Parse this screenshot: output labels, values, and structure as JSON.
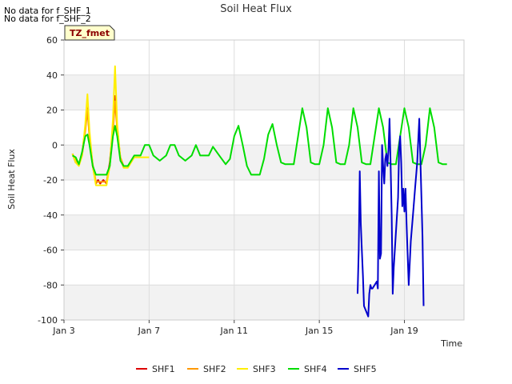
{
  "notes": [
    "No data for f_SHF_1",
    "No data for f_SHF_2"
  ],
  "badge": "TZ_fmet",
  "chart_data": {
    "type": "line",
    "title": "Soil Heat Flux",
    "xlabel": "Time",
    "ylabel": "Soil Heat Flux",
    "xlim": [
      3,
      21.8
    ],
    "ylim": [
      -100,
      60
    ],
    "xticks": [
      3,
      7,
      11,
      15,
      19
    ],
    "xtick_labels": [
      "Jan 3",
      "Jan 7",
      "Jan 11",
      "Jan 15",
      "Jan 19"
    ],
    "yticks": [
      -100,
      -80,
      -60,
      -40,
      -20,
      0,
      20,
      40,
      60
    ],
    "grid": true,
    "legend_position": "bottom",
    "series": [
      {
        "name": "SHF1",
        "color": "#dd0000",
        "values": [
          [
            3.4,
            -5
          ],
          [
            3.55,
            -10
          ],
          [
            3.7,
            -11
          ],
          [
            3.85,
            -5
          ],
          [
            4.0,
            10
          ],
          [
            4.1,
            22
          ],
          [
            4.2,
            5
          ],
          [
            4.35,
            -12
          ],
          [
            4.5,
            -22
          ],
          [
            4.6,
            -20
          ],
          [
            4.7,
            -22
          ],
          [
            4.85,
            -20
          ],
          [
            5.0,
            -22
          ],
          [
            5.15,
            -10
          ],
          [
            5.3,
            10
          ],
          [
            5.4,
            28
          ],
          [
            5.5,
            10
          ],
          [
            5.65,
            -8
          ],
          [
            5.8,
            -12
          ],
          [
            6.0,
            -12
          ]
        ]
      },
      {
        "name": "SHF2",
        "color": "#ff9900",
        "values": [
          [
            3.4,
            -5
          ],
          [
            3.55,
            -9
          ],
          [
            3.7,
            -11
          ],
          [
            3.85,
            -6
          ],
          [
            4.0,
            8
          ],
          [
            4.1,
            20
          ],
          [
            4.2,
            4
          ],
          [
            4.35,
            -11
          ],
          [
            4.5,
            -21
          ],
          [
            4.7,
            -21
          ],
          [
            5.0,
            -21
          ],
          [
            5.15,
            -12
          ],
          [
            5.3,
            8
          ],
          [
            5.4,
            25
          ],
          [
            5.5,
            8
          ],
          [
            5.65,
            -7
          ],
          [
            5.8,
            -12
          ],
          [
            6.0,
            -12
          ]
        ]
      },
      {
        "name": "SHF3",
        "color": "#ffee00",
        "values": [
          [
            3.4,
            -5
          ],
          [
            3.55,
            -10
          ],
          [
            3.7,
            -12
          ],
          [
            3.85,
            -6
          ],
          [
            4.0,
            12
          ],
          [
            4.1,
            29
          ],
          [
            4.2,
            8
          ],
          [
            4.35,
            -12
          ],
          [
            4.5,
            -23
          ],
          [
            4.7,
            -23
          ],
          [
            5.0,
            -23
          ],
          [
            5.15,
            -12
          ],
          [
            5.3,
            15
          ],
          [
            5.4,
            45
          ],
          [
            5.5,
            12
          ],
          [
            5.65,
            -8
          ],
          [
            5.8,
            -13
          ],
          [
            6.0,
            -13
          ],
          [
            6.3,
            -7
          ],
          [
            6.6,
            -7
          ],
          [
            7.0,
            -7
          ]
        ]
      },
      {
        "name": "SHF4",
        "color": "#00dd00",
        "values": [
          [
            3.4,
            -6
          ],
          [
            3.55,
            -7
          ],
          [
            3.7,
            -11
          ],
          [
            3.85,
            -4
          ],
          [
            4.0,
            5
          ],
          [
            4.1,
            6
          ],
          [
            4.2,
            0
          ],
          [
            4.35,
            -12
          ],
          [
            4.5,
            -17
          ],
          [
            4.7,
            -17
          ],
          [
            5.0,
            -17
          ],
          [
            5.15,
            -12
          ],
          [
            5.3,
            5
          ],
          [
            5.4,
            11
          ],
          [
            5.5,
            5
          ],
          [
            5.65,
            -9
          ],
          [
            5.8,
            -12
          ],
          [
            6.0,
            -12
          ],
          [
            6.3,
            -6
          ],
          [
            6.6,
            -6
          ],
          [
            6.8,
            0
          ],
          [
            7.0,
            0
          ],
          [
            7.2,
            -6
          ],
          [
            7.5,
            -9
          ],
          [
            7.8,
            -6
          ],
          [
            8.0,
            0
          ],
          [
            8.2,
            0
          ],
          [
            8.4,
            -6
          ],
          [
            8.7,
            -9
          ],
          [
            9.0,
            -6
          ],
          [
            9.2,
            0
          ],
          [
            9.4,
            -6
          ],
          [
            9.8,
            -6
          ],
          [
            10.0,
            -1
          ],
          [
            10.3,
            -6
          ],
          [
            10.6,
            -11
          ],
          [
            10.8,
            -8
          ],
          [
            11.0,
            5
          ],
          [
            11.2,
            11
          ],
          [
            11.4,
            0
          ],
          [
            11.6,
            -12
          ],
          [
            11.8,
            -17
          ],
          [
            12.0,
            -17
          ],
          [
            12.2,
            -17
          ],
          [
            12.4,
            -8
          ],
          [
            12.6,
            6
          ],
          [
            12.8,
            12
          ],
          [
            13.0,
            0
          ],
          [
            13.2,
            -10
          ],
          [
            13.4,
            -11
          ],
          [
            13.6,
            -11
          ],
          [
            13.8,
            -11
          ],
          [
            14.0,
            5
          ],
          [
            14.2,
            21
          ],
          [
            14.4,
            10
          ],
          [
            14.6,
            -10
          ],
          [
            14.8,
            -11
          ],
          [
            15.0,
            -11
          ],
          [
            15.2,
            0
          ],
          [
            15.4,
            21
          ],
          [
            15.6,
            10
          ],
          [
            15.8,
            -10
          ],
          [
            16.0,
            -11
          ],
          [
            16.2,
            -11
          ],
          [
            16.4,
            0
          ],
          [
            16.6,
            21
          ],
          [
            16.8,
            10
          ],
          [
            17.0,
            -10
          ],
          [
            17.2,
            -11
          ],
          [
            17.4,
            -11
          ],
          [
            17.6,
            5
          ],
          [
            17.8,
            21
          ],
          [
            18.0,
            10
          ],
          [
            18.2,
            -10
          ],
          [
            18.4,
            -11
          ],
          [
            18.6,
            -11
          ],
          [
            18.8,
            5
          ],
          [
            19.0,
            21
          ],
          [
            19.2,
            10
          ],
          [
            19.4,
            -10
          ],
          [
            19.6,
            -11
          ],
          [
            19.8,
            -11
          ],
          [
            20.0,
            0
          ],
          [
            20.2,
            21
          ],
          [
            20.4,
            10
          ],
          [
            20.6,
            -10
          ],
          [
            20.8,
            -11
          ],
          [
            21.0,
            -11
          ]
        ]
      },
      {
        "name": "SHF5",
        "color": "#0000cc",
        "values": [
          [
            16.8,
            -85
          ],
          [
            16.85,
            -60
          ],
          [
            16.9,
            -15
          ],
          [
            16.95,
            -45
          ],
          [
            17.0,
            -60
          ],
          [
            17.05,
            -75
          ],
          [
            17.1,
            -92
          ],
          [
            17.2,
            -95
          ],
          [
            17.3,
            -98
          ],
          [
            17.35,
            -85
          ],
          [
            17.4,
            -80
          ],
          [
            17.45,
            -82
          ],
          [
            17.5,
            -82
          ],
          [
            17.7,
            -78
          ],
          [
            17.75,
            -82
          ],
          [
            17.8,
            -15
          ],
          [
            17.85,
            -65
          ],
          [
            17.9,
            -62
          ],
          [
            17.95,
            0
          ],
          [
            18.0,
            -12
          ],
          [
            18.05,
            -22
          ],
          [
            18.1,
            -8
          ],
          [
            18.15,
            -5
          ],
          [
            18.2,
            -12
          ],
          [
            18.25,
            -3
          ],
          [
            18.3,
            15
          ],
          [
            18.35,
            -10
          ],
          [
            18.4,
            -40
          ],
          [
            18.45,
            -85
          ],
          [
            18.5,
            -70
          ],
          [
            18.6,
            -50
          ],
          [
            18.7,
            -30
          ],
          [
            18.75,
            -2
          ],
          [
            18.8,
            5
          ],
          [
            18.85,
            -10
          ],
          [
            18.9,
            -35
          ],
          [
            18.95,
            -25
          ],
          [
            19.0,
            -38
          ],
          [
            19.05,
            -25
          ],
          [
            19.1,
            -45
          ],
          [
            19.2,
            -80
          ],
          [
            19.3,
            -55
          ],
          [
            19.4,
            -40
          ],
          [
            19.5,
            -25
          ],
          [
            19.6,
            -10
          ],
          [
            19.7,
            15
          ],
          [
            19.8,
            -30
          ],
          [
            19.85,
            -52
          ],
          [
            19.9,
            -92
          ]
        ]
      }
    ]
  }
}
